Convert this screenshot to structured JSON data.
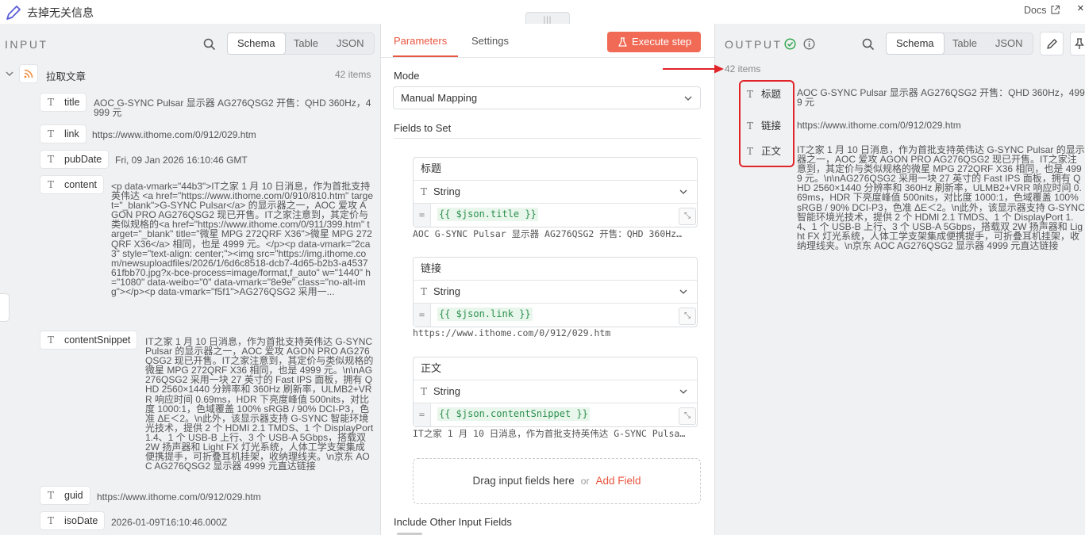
{
  "header": {
    "title": "去掉无关信息",
    "docs_label": "Docs",
    "close_glyph": "×",
    "drag_handle": "|||"
  },
  "input": {
    "title": "INPUT",
    "tabs": [
      "Schema",
      "Table",
      "JSON"
    ],
    "active_tab": "Schema",
    "node_name": "拉取文章",
    "item_count": "42 items",
    "fields": [
      {
        "name": "title",
        "value": "AOC G-SYNC Pulsar 显示器 AG276QSG2 开售：QHD 360Hz，4999 元"
      },
      {
        "name": "link",
        "value": "https://www.ithome.com/0/912/029.htm"
      },
      {
        "name": "pubDate",
        "value": "Fri, 09 Jan 2026 16:10:46 GMT"
      },
      {
        "name": "content",
        "value": "<p data-vmark=\"44b3\">IT之家 1 月 10 日消息，作为首批支持英伟达 <a href=\"https://www.ithome.com/0/910/810.htm\" target=\"_blank\">G-SYNC Pulsar</a> 的显示器之一，AOC 爱攻 AGON PRO AG276QSG2 现已开售。IT之家注意到，其定价与类似规格的<a href=\"https://www.ithome.com/0/911/399.htm\" target=\"_blank\" title=\"微星 MPG 272QRF X36\">微星 MPG 272QRF X36</a> 相同，也是 4999 元。</p><p data-vmark=\"2ca3\" style=\"text-align: center;\"><img src=\"https://img.ithome.com/newsuploadfiles/2026/1/6d6c8518-dcb7-4d65-b2b3-a453761fbb70.jpg?x-bce-process=image/format,f_auto\" w=\"1440\" h=\"1080\" data-weibo=\"0\" data-vmark=\"8e9e\" class=\"no-alt-img\"></p><p data-vmark=\"f5f1\">AG276QSG2 采用一..."
      },
      {
        "name": "contentSnippet",
        "value": "IT之家 1 月 10 日消息，作为首批支持英伟达 G-SYNC Pulsar 的显示器之一，AOC 爱攻 AGON PRO AG276QSG2 现已开售。IT之家注意到，其定价与类似规格的微星 MPG 272QRF X36 相同，也是 4999 元。\\n\\nAG276QSG2 采用一块 27 英寸的 Fast IPS 面板，拥有 QHD 2560×1440 分辨率和 360Hz 刷新率，ULMB2+VRR 响应时间 0.69ms，HDR 下亮度峰值 500nits，对比度 1000:1，色域覆盖 100% sRGB / 90% DCI-P3，色准 ΔE＜2。\\n此外，该显示器支持 G-SYNC 智能环境光技术，提供 2 个 HDMI 2.1 TMDS、1 个 DisplayPort 1.4、1 个 USB-B 上行、3 个 USB-A 5Gbps，搭载双 2W 扬声器和 Light FX 灯光系统，人体工学支架集成便携提手，可折叠耳机挂架，收纳理线夹。\\n京东 AOC AG276QSG2 显示器 4999 元直达链接"
      },
      {
        "name": "guid",
        "value": "https://www.ithome.com/0/912/029.htm"
      },
      {
        "name": "isoDate",
        "value": "2026-01-09T16:10:46.000Z"
      }
    ]
  },
  "params": {
    "tabs": [
      "Parameters",
      "Settings"
    ],
    "active_tab": "Parameters",
    "execute_label": "Execute step",
    "mode_label": "Mode",
    "mode_value": "Manual Mapping",
    "fields_label": "Fields to Set",
    "assignments": [
      {
        "name": "标题",
        "type": "String",
        "expression": "{{ $json.title }}",
        "preview": "AOC G-SYNC Pulsar 显示器 AG276QSG2 开售：QHD 360Hz…"
      },
      {
        "name": "链接",
        "type": "String",
        "expression": "{{ $json.link }}",
        "preview": "https://www.ithome.com/0/912/029.htm"
      },
      {
        "name": "正文",
        "type": "String",
        "expression": "{{ $json.contentSnippet }}",
        "preview": "IT之家 1 月 10 日消息，作为首批支持英伟达 G-SYNC Pulsa…"
      }
    ],
    "drop_text": "Drag input fields here",
    "drop_or": "or",
    "add_field": "Add Field",
    "include_other": "Include Other Input Fields"
  },
  "output": {
    "title": "OUTPUT",
    "tabs": [
      "Schema",
      "Table",
      "JSON"
    ],
    "active_tab": "Schema",
    "item_count": "42 items",
    "fields": [
      {
        "name": "标题",
        "value": "AOC G-SYNC Pulsar 显示器 AG276QSG2 开售：QHD 360Hz，4999 元"
      },
      {
        "name": "链接",
        "value": "https://www.ithome.com/0/912/029.htm"
      },
      {
        "name": "正文",
        "value": "IT之家 1 月 10 日消息，作为首批支持英伟达 G-SYNC Pulsar 的显示器之一，AOC 爱攻 AGON PRO AG276QSG2 现已开售。IT之家注意到，其定价与类似规格的微星 MPG 272QRF X36 相同，也是 4999 元。\\n\\nAG276QSG2 采用一块 27 英寸的 Fast IPS 面板，拥有 QHD 2560×1440 分辨率和 360Hz 刷新率，ULMB2+VRR 响应时间 0.69ms，HDR 下亮度峰值 500nits，对比度 1000:1，色域覆盖 100% sRGB / 90% DCI-P3，色准 ΔE＜2。\\n此外，该显示器支持 G-SYNC 智能环境光技术，提供 2 个 HDMI 2.1 TMDS、1 个 DisplayPort 1.4、1 个 USB-B 上行、3 个 USB-A 5Gbps，搭载双 2W 扬声器和 Light FX 灯光系统，人体工学支架集成便携提手，可折叠耳机挂架，收纳理线夹。\\n京东 AOC AG276QSG2 显示器 4999 元直达链接"
      }
    ]
  },
  "colors": {
    "accent": "#e8563f",
    "execute_bg": "#f06a55",
    "expression": "#2d8f4e",
    "annotation": "#e0242a",
    "success": "#36a854"
  },
  "icons": {
    "rss": "rss-icon",
    "type": "text-type-icon",
    "search": "search-icon",
    "edit": "pencil-icon",
    "check": "check-circle-icon",
    "info": "info-icon",
    "flask": "flask-icon",
    "chevron": "chevron-down-icon"
  }
}
